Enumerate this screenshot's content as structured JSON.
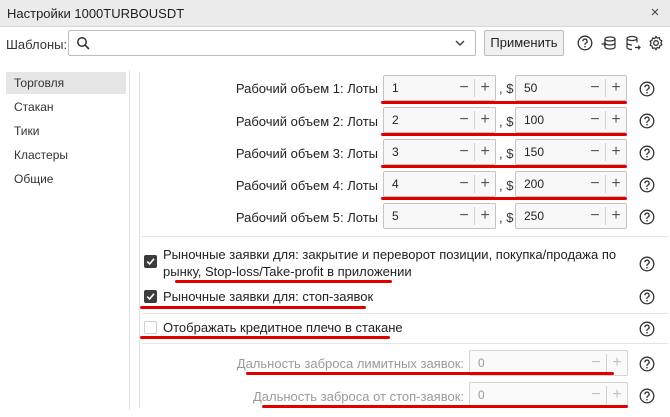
{
  "window": {
    "title": "Настройки 1000TURBOUSDT",
    "close_glyph": "×"
  },
  "toolbar": {
    "templates_label": "Шаблоны:",
    "search_value": "",
    "apply_label": "Применить",
    "icons": [
      "help-icon",
      "database-import-icon",
      "database-export-icon",
      "gear-icon"
    ]
  },
  "sidebar": {
    "items": [
      {
        "label": "Торговля",
        "active": true
      },
      {
        "label": "Стакан",
        "active": false
      },
      {
        "label": "Тики",
        "active": false
      },
      {
        "label": "Кластеры",
        "active": false
      },
      {
        "label": "Общие",
        "active": false
      }
    ]
  },
  "volumes": [
    {
      "label": "Рабочий объем 1: Лоты",
      "lots": "1",
      "usd": "50",
      "highlighted": true
    },
    {
      "label": "Рабочий объем 2: Лоты",
      "lots": "2",
      "usd": "100",
      "highlighted": true
    },
    {
      "label": "Рабочий объем 3: Лоты",
      "lots": "3",
      "usd": "150",
      "highlighted": true
    },
    {
      "label": "Рабочий объем 4: Лоты",
      "lots": "4",
      "usd": "200",
      "highlighted": true
    },
    {
      "label": "Рабочий объем 5: Лоты",
      "lots": "5",
      "usd": "250",
      "highlighted": false
    }
  ],
  "spinner": {
    "minus": "−",
    "plus": "+",
    "usd_sep": ", $"
  },
  "options": {
    "market_orders_line1": "Рыночные заявки для: закрытие и переворот позиции, покупка/продажа по",
    "market_orders_line2": "рынку, Stop-loss/Take-profit в приложении",
    "market_orders_checked": true,
    "stop_orders": "Рыночные заявки для: стоп-заявок",
    "stop_orders_checked": true,
    "leverage": "Отображать кредитное плечо в стакане",
    "leverage_checked": false
  },
  "distances": {
    "limit_label": "Дальность заброса лимитных заявок:",
    "limit_value": "0",
    "stop_label": "Дальность заброса от стоп-заявок:",
    "stop_value": "0"
  },
  "colors": {
    "annotation_red": "#e00000",
    "checkbox_dark": "#3b3b3b"
  }
}
